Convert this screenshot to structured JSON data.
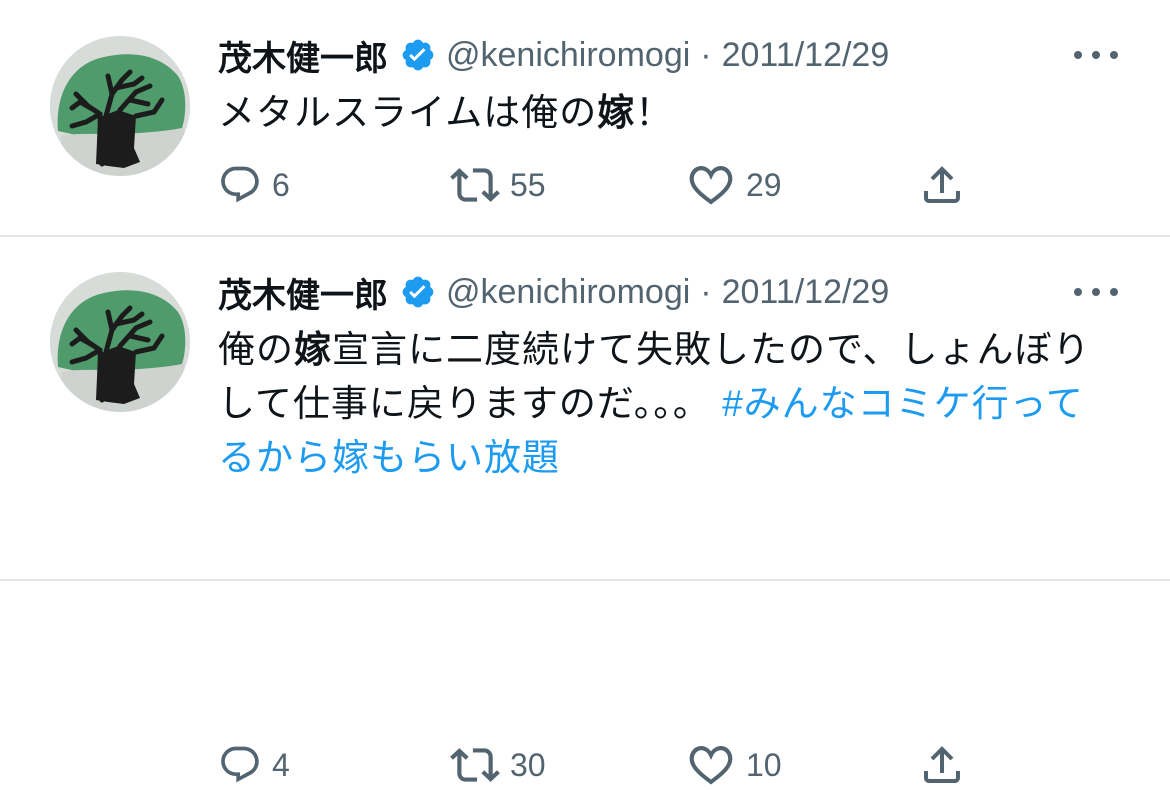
{
  "colors": {
    "accent": "#1d9bf0",
    "secondary_text": "#536471",
    "primary_text": "#0f1419",
    "divider": "#e3e5e8"
  },
  "tweets": [
    {
      "author_name": "茂木健一郎",
      "handle": "@kenichiromogi",
      "separator": "·",
      "date": "2011/12/29",
      "verified_icon": "verified-badge-icon",
      "text_plain": "メタルスライムは俺の",
      "text_bold": "嫁",
      "text_end": "！",
      "reply_count": "6",
      "retweet_count": "55",
      "like_count": "29"
    },
    {
      "author_name": "茂木健一郎",
      "handle": "@kenichiromogi",
      "separator": "·",
      "date": "2011/12/29",
      "verified_icon": "verified-badge-icon",
      "text_prefix": "俺の",
      "text_bold": "嫁",
      "text_rest": "宣言に二度続けて失敗したので、しょんぼりして仕事に戻りますのだ。。。 ",
      "hashtag": "#みんなコミケ行ってるから嫁もらい放題",
      "reply_count": "4",
      "retweet_count": "30",
      "like_count": "10"
    }
  ]
}
